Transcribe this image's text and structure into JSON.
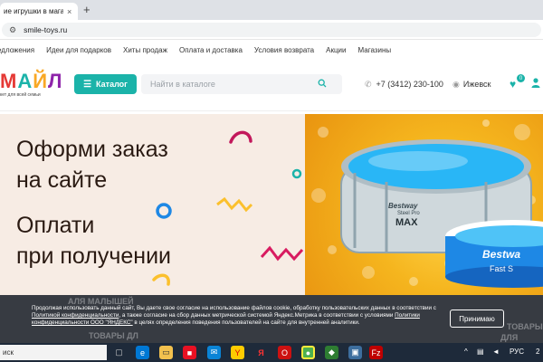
{
  "browser": {
    "tab_title": "ие игрушки в магазине",
    "tab_close": "×",
    "new_tab": "+",
    "url": "smile-toys.ru"
  },
  "top_links": [
    "едложения",
    "Идеи для подарков",
    "Хиты продаж",
    "Оплата и доставка",
    "Условия возврата",
    "Акции",
    "Магазины"
  ],
  "header": {
    "logo_letters": [
      "М",
      "А",
      "Й",
      "Л"
    ],
    "logo_colors": [
      "#e53935",
      "#1bb3a9",
      "#f9a825",
      "#8e24aa"
    ],
    "logo_tagline": "кет для всей семьи",
    "catalog_label": "Каталог",
    "search_placeholder": "Найти в каталоге",
    "phone": "+7 (3412) 230-100",
    "city": "Ижевск",
    "favorites_count": "0"
  },
  "hero": {
    "line1": "Оформи заказ",
    "line2": "на сайте",
    "line3": "Оплати",
    "line4": "при получении",
    "pool_brand": "Bestway",
    "pool_model_1": "Steel Pro",
    "pool_model_2": "MAX",
    "pool2_brand": "Bestwa",
    "pool2_model": "Fast S"
  },
  "cookie": {
    "text_1": "Продолжая использовать данный сайт, Вы даете свое согласие на использование файлов cookie, обработку пользовательских данных в соответствии с ",
    "link_1": "Политикой конфиденциальности",
    "text_2": ", а также согласие на сбор данных метрической системой Яндекс.Метрика в соответствии с условиями ",
    "link_2": "Политики конфиденциальности ООО \"ЯНДЕКС\"",
    "text_3": " в целях определения поведения пользователей на сайте для внутренней аналитики.",
    "accept_label": "Принимаю",
    "peek_left_1": "ТОВАРЫ ДЛ",
    "peek_left_2": "АЛЯ МАЛЫШЕЙ",
    "peek_right_1": "ТОВАРЫ",
    "peek_right_2": "ДЛЯ ШКОЛЫ"
  },
  "taskbar": {
    "search_text": "иск",
    "lang": "РУС",
    "clock": "2"
  }
}
